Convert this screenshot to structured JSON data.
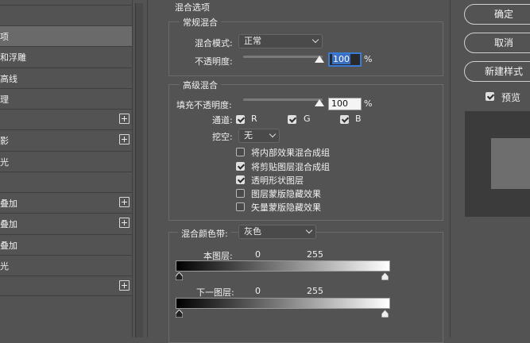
{
  "left_list": {
    "items": [
      {
        "label": "",
        "has_plus": false
      },
      {
        "label": "项",
        "selected": true,
        "has_plus": false
      },
      {
        "label": "和浮雕",
        "has_plus": false
      },
      {
        "label": "高线",
        "has_plus": false
      },
      {
        "label": "理",
        "has_plus": false
      },
      {
        "label": "",
        "has_plus": true
      },
      {
        "label": "影",
        "has_plus": true
      },
      {
        "label": "光",
        "has_plus": false
      },
      {
        "label": "",
        "has_plus": false
      },
      {
        "label": "叠加",
        "has_plus": true
      },
      {
        "label": "叠加",
        "has_plus": true
      },
      {
        "label": "叠加",
        "has_plus": false
      },
      {
        "label": "光",
        "has_plus": false
      },
      {
        "label": "",
        "has_plus": true
      }
    ]
  },
  "section_title": "混合选项",
  "general_blend": {
    "title": "常规混合",
    "mode_label": "混合模式:",
    "mode_value": "正常",
    "opacity_label": "不透明度:",
    "opacity_value": "100",
    "opacity_unit": "%",
    "opacity_level": 100
  },
  "advanced_blend": {
    "title": "高级混合",
    "fill_label": "填充不透明度:",
    "fill_value": "100",
    "fill_unit": "%",
    "fill_level": 100,
    "channels_label": "通道:",
    "channels": [
      {
        "label": "R",
        "checked": true
      },
      {
        "label": "G",
        "checked": true
      },
      {
        "label": "B",
        "checked": true
      }
    ],
    "knockout_label": "挖空:",
    "knockout_value": "无",
    "options": [
      {
        "label": "将内部效果混合成组",
        "checked": false
      },
      {
        "label": "将剪贴图层混合成组",
        "checked": true
      },
      {
        "label": "透明形状图层",
        "checked": true
      },
      {
        "label": "图层蒙版隐藏效果",
        "checked": false
      },
      {
        "label": "矢量蒙版隐藏效果",
        "checked": false
      }
    ]
  },
  "blend_if": {
    "label": "混合颜色带:",
    "value": "灰色",
    "this_layer": {
      "label": "本图层:",
      "min": "0",
      "max": "255"
    },
    "underlying": {
      "label": "下一图层:",
      "min": "0",
      "max": "255"
    }
  },
  "buttons": {
    "ok": "确定",
    "cancel": "取消",
    "new_style": "新建样式"
  },
  "preview": {
    "label": "预览",
    "checked": true
  },
  "colors": {
    "background": "#535353",
    "accent_focus": "#3a7bd5"
  }
}
